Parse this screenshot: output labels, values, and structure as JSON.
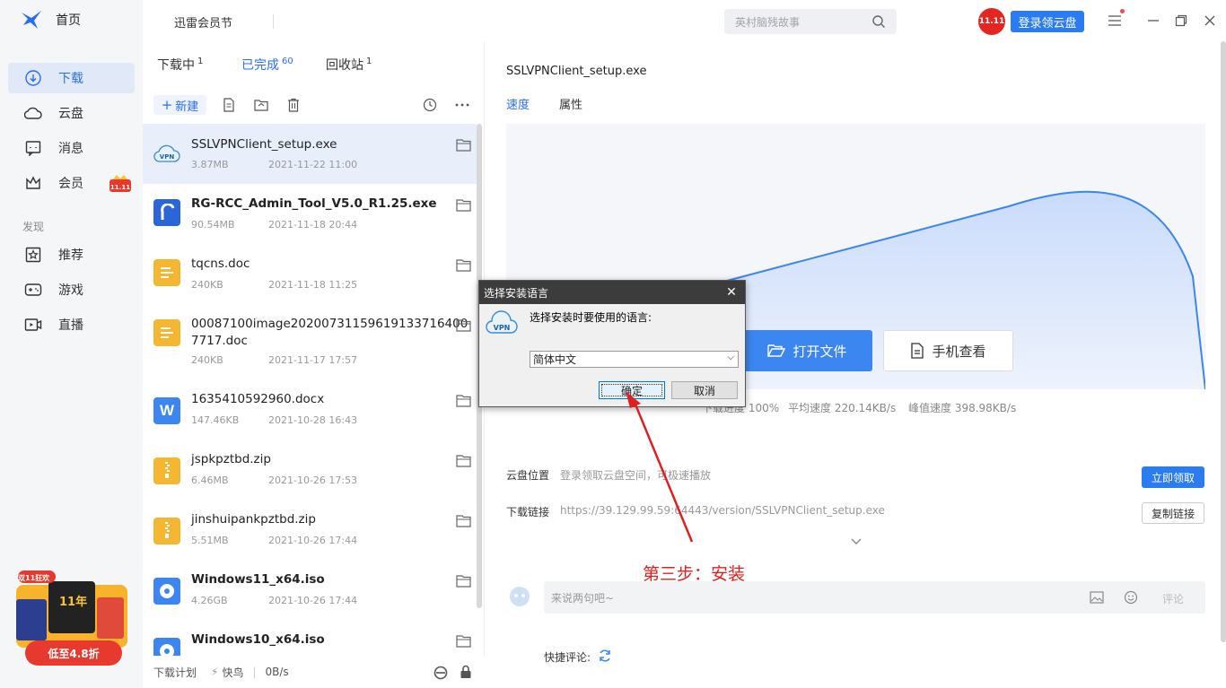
{
  "sidebar": {
    "home_label": "首页",
    "items": [
      {
        "label": "下载",
        "icon": "download-icon",
        "active": true
      },
      {
        "label": "云盘",
        "icon": "cloud-icon"
      },
      {
        "label": "消息",
        "icon": "message-icon"
      },
      {
        "label": "会员",
        "icon": "crown-icon"
      }
    ],
    "discover_label": "发现",
    "discover_items": [
      {
        "label": "推荐",
        "icon": "star-icon"
      },
      {
        "label": "游戏",
        "icon": "gamepad-icon"
      },
      {
        "label": "直播",
        "icon": "live-icon"
      }
    ],
    "promo": {
      "badge": "双11狂欢",
      "years": "11年",
      "button": "低至4.8折"
    }
  },
  "topbar": {
    "vip_festival": "迅雷会员节",
    "search_placeholder": "英村脑残故事",
    "badge_text": "11.11",
    "login_button": "登录领云盘"
  },
  "list": {
    "tabs": [
      {
        "label": "下载中",
        "count": "1"
      },
      {
        "label": "已完成",
        "count": "60",
        "active": true
      },
      {
        "label": "回收站",
        "count": "1"
      }
    ],
    "new_button": "新建",
    "files": [
      {
        "name": "SSLVPNClient_setup.exe",
        "size": "3.87MB",
        "date": "2021-11-22 11:00",
        "icon": "vpn",
        "selected": true
      },
      {
        "name": "RG-RCC_Admin_Tool_V5.0_R1.25.exe",
        "size": "90.54MB",
        "date": "2021-11-18 20:44",
        "icon": "rg",
        "bold": true
      },
      {
        "name": "tqcns.doc",
        "size": "240KB",
        "date": "2021-11-18 11:25",
        "icon": "doc"
      },
      {
        "name": "00087100image20200731159619133716400 7717.doc",
        "size": "240KB",
        "date": "2021-11-17 17:57",
        "icon": "doc"
      },
      {
        "name": "1635410592960.docx",
        "size": "147.46KB",
        "date": "2021-10-28 16:43",
        "icon": "word"
      },
      {
        "name": "jspkpztbd.zip",
        "size": "6.46MB",
        "date": "2021-10-26 17:53",
        "icon": "zip"
      },
      {
        "name": "jinshuipankpztbd.zip",
        "size": "5.51MB",
        "date": "2021-10-26 17:44",
        "icon": "zip"
      },
      {
        "name": "Windows11_x64.iso",
        "size": "4.26GB",
        "date": "2021-10-26 17:44",
        "icon": "iso",
        "bold": true
      },
      {
        "name": "Windows10_x64.iso",
        "size": "",
        "date": "",
        "icon": "iso",
        "bold": true
      }
    ],
    "footer": {
      "plan": "下载计划",
      "mode": "快鸟",
      "speed": "0B/s"
    }
  },
  "detail": {
    "title": "SSLVPNClient_setup.exe",
    "tabs": [
      {
        "label": "速度",
        "active": true
      },
      {
        "label": "属性"
      }
    ],
    "open_button": "打开文件",
    "phone_button": "手机查看",
    "stats": {
      "progress": "下载进度 100%",
      "avg": "平均速度 220.14KB/s",
      "peak": "峰值速度 398.98KB/s"
    },
    "cloud_label": "云盘位置",
    "cloud_value": "登录领取云盘空间，可极速播放",
    "claim_button": "立即领取",
    "link_label": "下载链接",
    "link_value": "https://39.129.99.59:64443/version/SSLVPNClient_setup.exe",
    "copy_button": "复制链接",
    "comment_placeholder": "来说两句吧~",
    "comment_button": "评论",
    "quick_label": "快捷评论:"
  },
  "dialog": {
    "title": "选择安装语言",
    "prompt": "选择安装时要使用的语言:",
    "selected_language": "简体中文",
    "ok": "确定",
    "cancel": "取消"
  },
  "annotation": "第三步：安装",
  "colors": {
    "accent": "#2a6ef0",
    "annotation": "#e02020"
  }
}
